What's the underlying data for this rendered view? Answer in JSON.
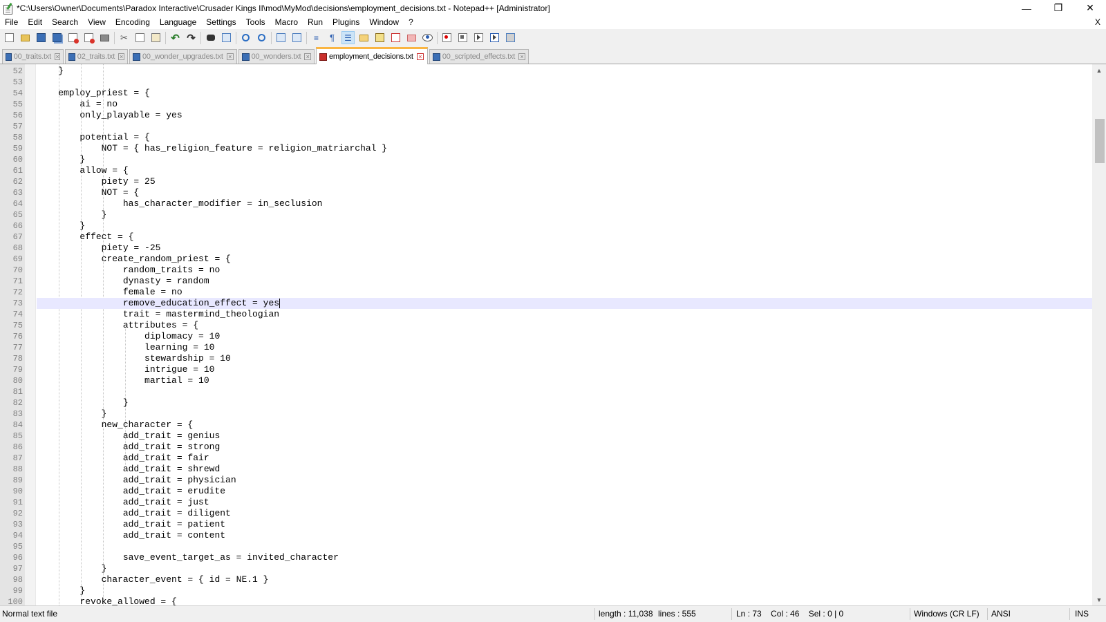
{
  "window": {
    "title": "*C:\\Users\\Owner\\Documents\\Paradox Interactive\\Crusader Kings II\\mod\\MyMod\\decisions\\employment_decisions.txt - Notepad++ [Administrator]",
    "minimize_glyph": "—",
    "maximize_glyph": "❐",
    "close_glyph": "✕"
  },
  "menu": {
    "items": [
      "File",
      "Edit",
      "Search",
      "View",
      "Encoding",
      "Language",
      "Settings",
      "Tools",
      "Macro",
      "Run",
      "Plugins",
      "Window",
      "?"
    ],
    "close_label": "X"
  },
  "toolbar": {
    "icons": [
      "new-file-icon",
      "open-file-icon",
      "save-icon",
      "save-all-icon",
      "close-icon",
      "close-all-icon",
      "print-icon",
      "cut-icon",
      "copy-icon",
      "paste-icon",
      "undo-icon",
      "redo-icon",
      "find-icon",
      "replace-icon",
      "zoom-in-icon",
      "zoom-out-icon",
      "sync-vertical-icon",
      "sync-horizontal-icon",
      "word-wrap-icon",
      "show-all-chars-icon",
      "indent-guide-icon",
      "document-map-icon",
      "function-list-icon",
      "folder-workspace-icon",
      "doc-switcher-icon",
      "monitoring-icon",
      "record-macro-icon",
      "stop-macro-icon",
      "play-macro-icon",
      "run-macro-multiple-icon",
      "save-macro-icon"
    ]
  },
  "tabs": [
    {
      "label": "00_traits.txt",
      "active": false,
      "modified": false
    },
    {
      "label": "02_traits.txt",
      "active": false,
      "modified": false
    },
    {
      "label": "00_wonder_upgrades.txt",
      "active": false,
      "modified": false
    },
    {
      "label": "00_wonders.txt",
      "active": false,
      "modified": false
    },
    {
      "label": "employment_decisions.txt",
      "active": true,
      "modified": true
    },
    {
      "label": "00_scripted_effects.txt",
      "active": false,
      "modified": false
    }
  ],
  "editor": {
    "current_line": 73,
    "lines": [
      {
        "n": "52",
        "text": "    }"
      },
      {
        "n": "53",
        "text": ""
      },
      {
        "n": "54",
        "text": "    employ_priest = {"
      },
      {
        "n": "55",
        "text": "        ai = no"
      },
      {
        "n": "56",
        "text": "        only_playable = yes"
      },
      {
        "n": "57",
        "text": ""
      },
      {
        "n": "58",
        "text": "        potential = {"
      },
      {
        "n": "59",
        "text": "            NOT = { has_religion_feature = religion_matriarchal }"
      },
      {
        "n": "60",
        "text": "        }"
      },
      {
        "n": "61",
        "text": "        allow = {"
      },
      {
        "n": "62",
        "text": "            piety = 25"
      },
      {
        "n": "63",
        "text": "            NOT = {"
      },
      {
        "n": "64",
        "text": "                has_character_modifier = in_seclusion"
      },
      {
        "n": "65",
        "text": "            }"
      },
      {
        "n": "66",
        "text": "        }"
      },
      {
        "n": "67",
        "text": "        effect = {"
      },
      {
        "n": "68",
        "text": "            piety = -25"
      },
      {
        "n": "69",
        "text": "            create_random_priest = {"
      },
      {
        "n": "70",
        "text": "                random_traits = no"
      },
      {
        "n": "71",
        "text": "                dynasty = random"
      },
      {
        "n": "72",
        "text": "                female = no"
      },
      {
        "n": "73",
        "text": "                remove_education_effect = yes"
      },
      {
        "n": "74",
        "text": "                trait = mastermind_theologian"
      },
      {
        "n": "75",
        "text": "                attributes = {"
      },
      {
        "n": "76",
        "text": "                    diplomacy = 10"
      },
      {
        "n": "77",
        "text": "                    learning = 10"
      },
      {
        "n": "78",
        "text": "                    stewardship = 10"
      },
      {
        "n": "79",
        "text": "                    intrigue = 10"
      },
      {
        "n": "80",
        "text": "                    martial = 10"
      },
      {
        "n": "81",
        "text": ""
      },
      {
        "n": "82",
        "text": "                }"
      },
      {
        "n": "83",
        "text": "            }"
      },
      {
        "n": "84",
        "text": "            new_character = {"
      },
      {
        "n": "85",
        "text": "                add_trait = genius"
      },
      {
        "n": "86",
        "text": "                add_trait = strong"
      },
      {
        "n": "87",
        "text": "                add_trait = fair"
      },
      {
        "n": "88",
        "text": "                add_trait = shrewd"
      },
      {
        "n": "89",
        "text": "                add_trait = physician"
      },
      {
        "n": "90",
        "text": "                add_trait = erudite"
      },
      {
        "n": "91",
        "text": "                add_trait = just"
      },
      {
        "n": "92",
        "text": "                add_trait = diligent"
      },
      {
        "n": "93",
        "text": "                add_trait = patient"
      },
      {
        "n": "94",
        "text": "                add_trait = content"
      },
      {
        "n": "95",
        "text": ""
      },
      {
        "n": "96",
        "text": "                save_event_target_as = invited_character"
      },
      {
        "n": "97",
        "text": "            }"
      },
      {
        "n": "98",
        "text": "            character_event = { id = NE.1 }"
      },
      {
        "n": "99",
        "text": "        }"
      },
      {
        "n": "100",
        "text": "        revoke_allowed = {"
      }
    ]
  },
  "scrollbar": {
    "up_glyph": "▲",
    "down_glyph": "▼",
    "position_fraction": 0.09
  },
  "status": {
    "file_type": "Normal text file",
    "length": "length : 11,038",
    "lines": "lines : 555",
    "position": "Ln : 73    Col : 46    Sel : 0 | 0",
    "eol": "Windows (CR LF)",
    "encoding": "ANSI",
    "mode": "INS"
  },
  "colors": {
    "current_line_bg": "#e8e8ff",
    "active_tab_accent": "#fab542",
    "line_number": "#808080"
  }
}
